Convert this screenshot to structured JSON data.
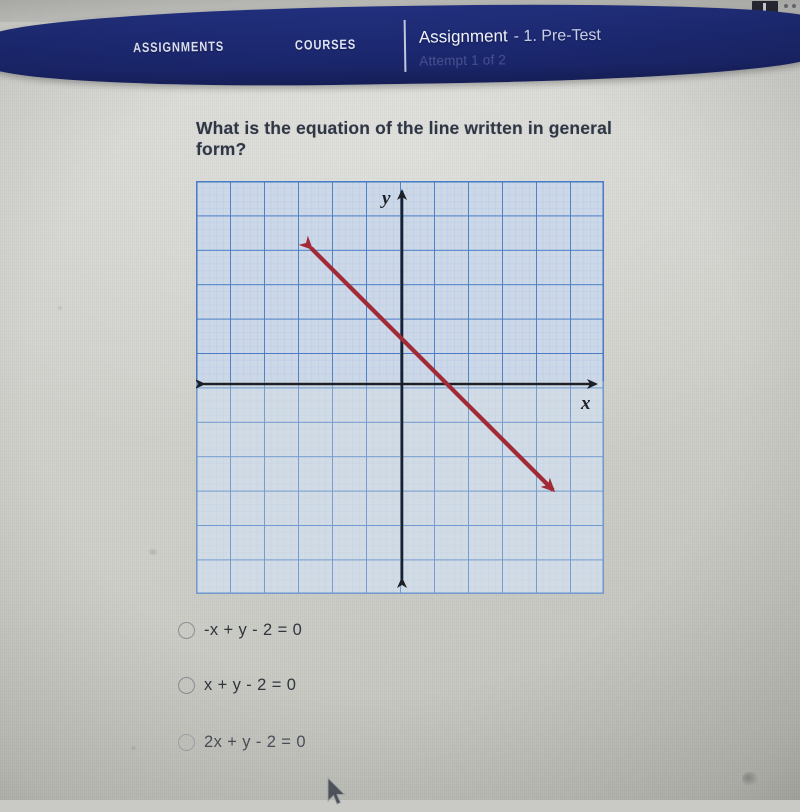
{
  "window": {
    "top_chip_icon": "window-chip-icon"
  },
  "nav": {
    "items": [
      {
        "label": "ASSIGNMENTS",
        "name": "nav-item-assignments"
      },
      {
        "label": "COURSES",
        "name": "nav-item-courses"
      }
    ],
    "assignment_title": "Assignment",
    "assignment_subtitle": "- 1. Pre-Test",
    "attempt": "Attempt 1 of 2"
  },
  "question": {
    "text": "What is the equation of the line written in general form?"
  },
  "graph": {
    "x_axis_label": "x",
    "y_axis_label": "y",
    "grid_color": "#5b87c9",
    "minor_grid_color": "#9dbbdf",
    "axis_color": "#1d2026",
    "line_color": "#a32b38",
    "plot_background": "#cdd8e8"
  },
  "options": [
    {
      "label": "-x + y - 2 = 0",
      "selected": false
    },
    {
      "label": "x + y - 2 = 0",
      "selected": false
    },
    {
      "label": "2x + y - 2 = 0",
      "selected": false
    }
  ],
  "chart_data": {
    "type": "line",
    "title": "",
    "xlabel": "x",
    "ylabel": "y",
    "xlim": [
      -6,
      6
    ],
    "ylim": [
      -6,
      6
    ],
    "grid": true,
    "major_grid_step": 1,
    "minor_grid_step": 0.2,
    "legend": "none",
    "series": [
      {
        "name": "line",
        "equation": "x + y - 2 = 0",
        "slope": -1,
        "y_intercept": 2,
        "x_intercept": 2,
        "color": "#a32b38",
        "arrow_both_ends": true,
        "x": [
          -3,
          4.5
        ],
        "y": [
          5,
          -2.5
        ]
      }
    ],
    "annotations": [
      {
        "text": "y",
        "x": 0,
        "y": 6,
        "placement": "axis-label-top"
      },
      {
        "text": "x",
        "x": 6,
        "y": 0,
        "placement": "axis-label-right"
      }
    ]
  }
}
